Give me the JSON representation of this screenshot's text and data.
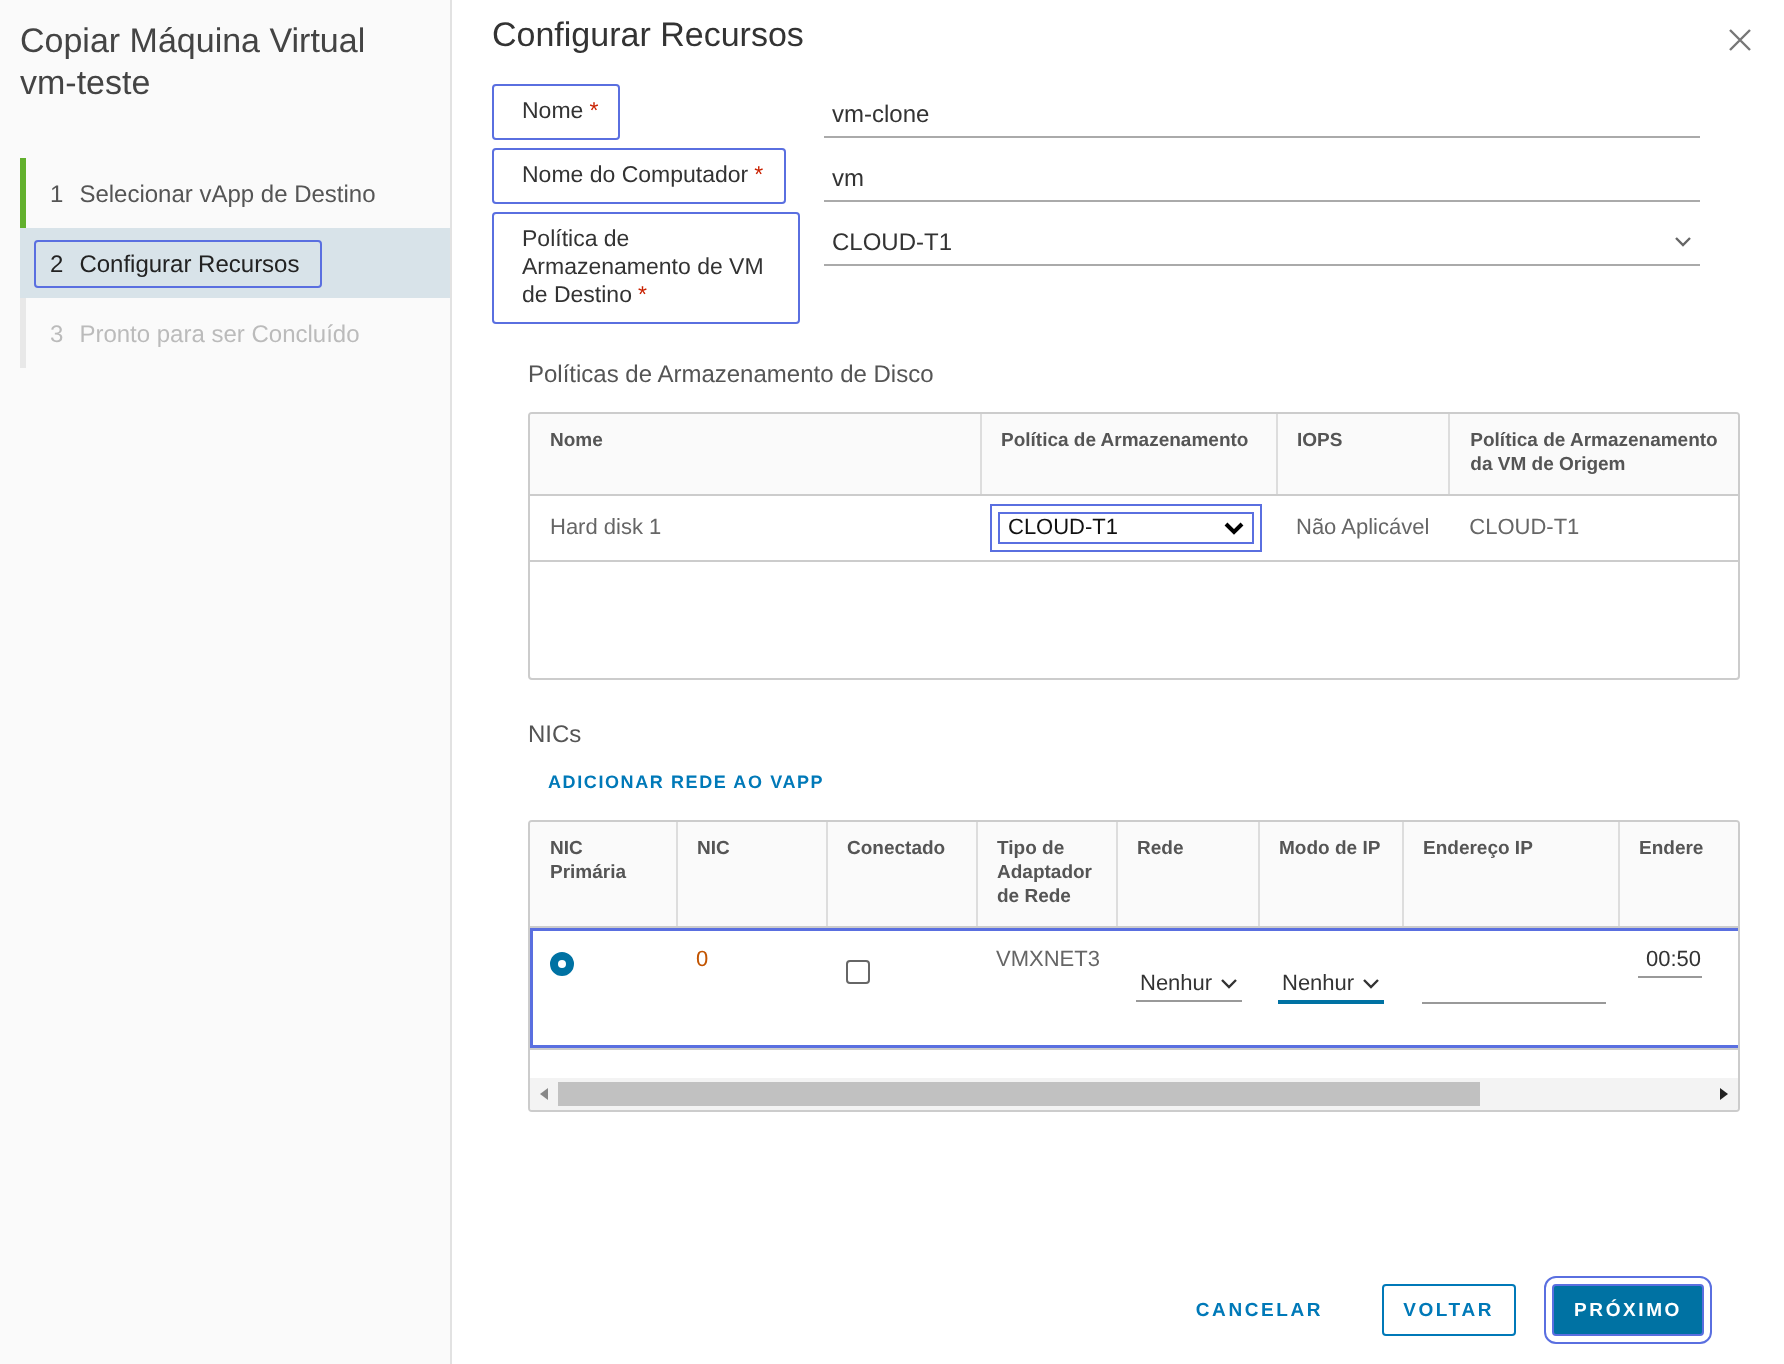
{
  "wizard": {
    "title": "Copiar Máquina Virtual vm-teste",
    "steps": [
      {
        "number": "1",
        "label": "Selecionar vApp de Destino",
        "selected": false,
        "kind": "done",
        "highlighted": false
      },
      {
        "number": "2",
        "label": "Configurar Recursos",
        "selected": true,
        "kind": "current",
        "highlighted": true
      },
      {
        "number": "3",
        "label": "Pronto para ser Concluído",
        "selected": false,
        "kind": "pending",
        "highlighted": false
      }
    ]
  },
  "page": {
    "title": "Configurar Recursos"
  },
  "fields": [
    {
      "label": "Nome",
      "required_mark": "*",
      "value": "vm-clone",
      "kind": "text",
      "highlighted": true
    },
    {
      "label": "Nome do Computador",
      "required_mark": "*",
      "value": "vm",
      "kind": "text",
      "highlighted": true
    },
    {
      "label": "Política de Armazenamento de VM de Destino",
      "required_mark": "*",
      "value": "CLOUD-T1",
      "kind": "select",
      "highlighted": true
    }
  ],
  "disk_section": {
    "title": "Políticas de Armazenamento de Disco",
    "columns": [
      "Nome",
      "Política de Armazenamento",
      "IOPS",
      "Política de Armazenamento da VM de Origem"
    ],
    "rows": [
      {
        "name": "Hard disk 1",
        "policy": "CLOUD-T1",
        "policy_highlighted": true,
        "iops": "Não Aplicável",
        "source_policy": "CLOUD-T1"
      }
    ]
  },
  "nic_section": {
    "title": "NICs",
    "add_link": "ADICIONAR REDE AO VAPP",
    "columns": [
      "NIC Primária",
      "NIC",
      "Conectado",
      "Tipo de Adaptador de Rede",
      "Rede",
      "Modo de IP",
      "Endereço IP",
      "Endere"
    ],
    "rows": [
      {
        "primary": true,
        "nic": "0",
        "connected": false,
        "adapter": "VMXNET3",
        "network": "Nenhur",
        "network_active": false,
        "ip_mode": "Nenhur",
        "ip_mode_active": true,
        "mac": "00:50",
        "highlighted": true
      }
    ]
  },
  "buttons": [
    {
      "label": "CANCELAR",
      "kind": "link",
      "highlighted": false
    },
    {
      "label": "VOLTAR",
      "kind": "outline",
      "highlighted": false
    },
    {
      "label": "PRÓXIMO",
      "kind": "primary",
      "highlighted": true
    }
  ]
}
